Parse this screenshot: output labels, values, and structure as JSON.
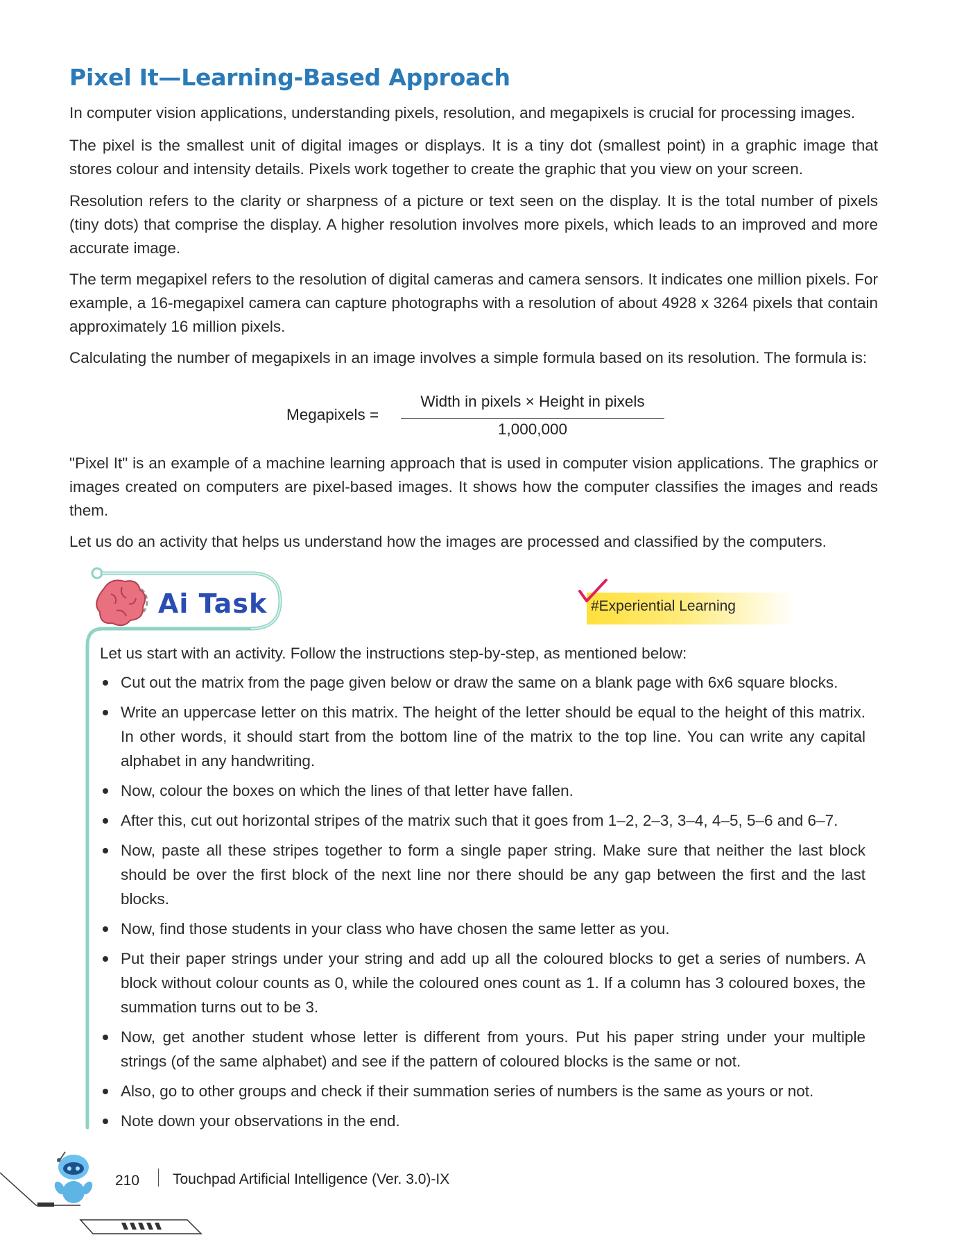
{
  "heading": "Pixel It—Learning-Based Approach",
  "paragraphs": [
    "In computer vision applications, understanding pixels, resolution, and megapixels is crucial for processing images.",
    "The pixel is the smallest unit of digital images or displays. It is a tiny dot (smallest point) in a graphic image that stores colour and intensity details. Pixels work together to create the graphic that you view on your screen.",
    "Resolution refers to the clarity or sharpness of a picture or text seen on the display. It is the total number of pixels (tiny dots) that comprise the display. A higher resolution involves more pixels, which leads to an improved and more accurate image.",
    "The term megapixel refers to the resolution of digital cameras and camera sensors. It indicates one million pixels. For example, a 16-megapixel camera can capture photographs with a resolution of about 4928 x 3264 pixels that contain approximately 16 million pixels.",
    "Calculating the number of megapixels in an image involves a simple formula based on its resolution. The formula is:",
    "\"Pixel It\" is an example of a machine learning approach that is used in computer vision applications. The graphics or images created on computers are pixel-based images. It shows how the computer classifies the images and reads them.",
    "Let us do an activity that helps us understand how the images are processed and classified by the computers."
  ],
  "formula": {
    "lhs": "Megapixels =",
    "numerator": "Width in pixels × Height in pixels",
    "denominator": "1,000,000"
  },
  "ai_task": {
    "label": "Ai Task",
    "badge": "#Experiential Learning",
    "intro": "Let us start with an activity. Follow the instructions step-by-step, as mentioned below:",
    "steps": [
      "Cut out the matrix from the page given below or draw the same on a blank page with 6x6 square blocks.",
      "Write an uppercase letter on this matrix. The height of the letter should be equal to the height of this matrix. In other words, it should start from the bottom line of the matrix to the top line. You can write any capital alphabet in any handwriting.",
      "Now, colour the boxes on which the lines of that letter have fallen.",
      "After this, cut out horizontal stripes of the matrix such that it goes from 1–2, 2–3, 3–4, 4–5, 5–6 and 6–7.",
      "Now, paste all these stripes together to form a single paper string. Make sure that neither the last block should be over the first block of the next line nor there should be any gap between the first and the last blocks.",
      "Now, find those students in your class who have chosen the same letter as you.",
      "Put their paper strings under your string and add up all the coloured blocks to get a series of numbers. A block without colour counts as 0, while the coloured ones count as 1. If a column has 3 coloured boxes, the summation turns out to be 3.",
      "Now, get another student whose letter is different from yours. Put his paper string under your multiple strings (of the same alphabet) and see if the pattern of coloured blocks is the same or not.",
      "Also, go to other groups and check if their summation series of numbers is the same as yours or not.",
      "Note down your observations in the end."
    ]
  },
  "footer": {
    "page_number": "210",
    "book_title": "Touchpad Artificial Intelligence (Ver. 3.0)-IX"
  },
  "colors": {
    "heading": "#2a7ab8",
    "ai_task_text": "#2a4db3",
    "frame_teal": "#8fd3c4",
    "badge_yellow": "#ffe03a",
    "check_pink": "#e0215e"
  },
  "icons": [
    "brain-gear-icon",
    "check-mark-icon",
    "robot-mascot-icon"
  ]
}
